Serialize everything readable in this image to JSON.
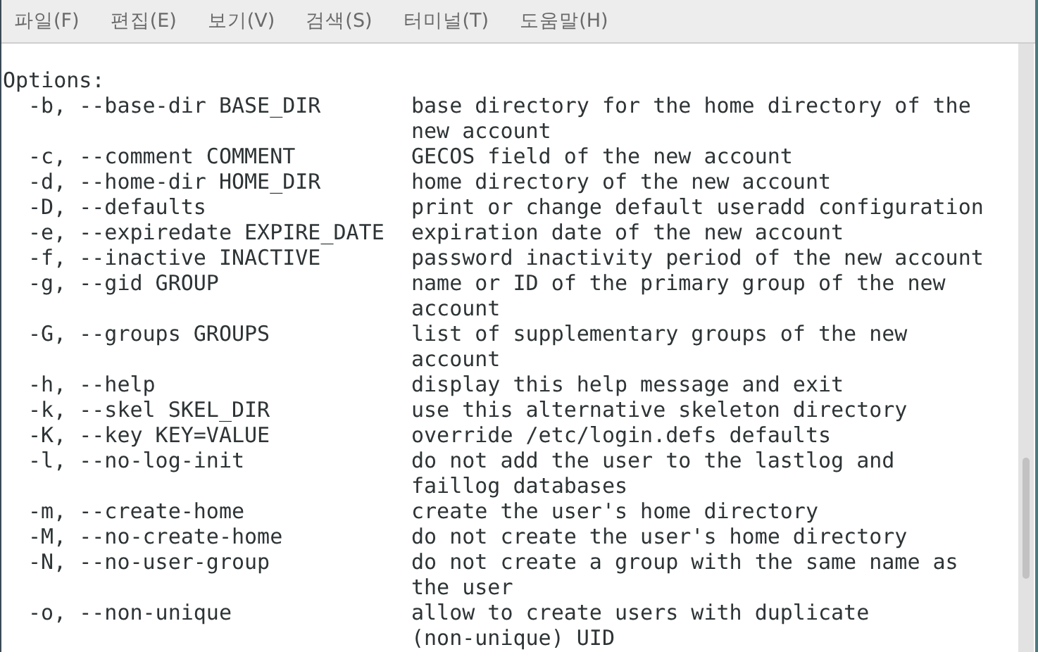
{
  "menu": [
    {
      "label": "파일(F)"
    },
    {
      "label": "편집(E)"
    },
    {
      "label": "보기(V)"
    },
    {
      "label": "검색(S)"
    },
    {
      "label": "터미널(T)"
    },
    {
      "label": "도움말(H)"
    }
  ],
  "terminal": {
    "heading": "Options:",
    "options": [
      {
        "flag": "-b, --base-dir BASE_DIR",
        "description": [
          "base directory for the home directory of the",
          "new account"
        ]
      },
      {
        "flag": "-c, --comment COMMENT",
        "description": [
          "GECOS field of the new account"
        ]
      },
      {
        "flag": "-d, --home-dir HOME_DIR",
        "description": [
          "home directory of the new account"
        ]
      },
      {
        "flag": "-D, --defaults",
        "description": [
          "print or change default useradd configuration"
        ]
      },
      {
        "flag": "-e, --expiredate EXPIRE_DATE",
        "description": [
          "expiration date of the new account"
        ]
      },
      {
        "flag": "-f, --inactive INACTIVE",
        "description": [
          "password inactivity period of the new account"
        ]
      },
      {
        "flag": "-g, --gid GROUP",
        "description": [
          "name or ID of the primary group of the new",
          "account"
        ]
      },
      {
        "flag": "-G, --groups GROUPS",
        "description": [
          "list of supplementary groups of the new",
          "account"
        ]
      },
      {
        "flag": "-h, --help",
        "description": [
          "display this help message and exit"
        ]
      },
      {
        "flag": "-k, --skel SKEL_DIR",
        "description": [
          "use this alternative skeleton directory"
        ]
      },
      {
        "flag": "-K, --key KEY=VALUE",
        "description": [
          "override /etc/login.defs defaults"
        ]
      },
      {
        "flag": "-l, --no-log-init",
        "description": [
          "do not add the user to the lastlog and",
          "faillog databases"
        ]
      },
      {
        "flag": "-m, --create-home",
        "description": [
          "create the user's home directory"
        ]
      },
      {
        "flag": "-M, --no-create-home",
        "description": [
          "do not create the user's home directory"
        ]
      },
      {
        "flag": "-N, --no-user-group",
        "description": [
          "do not create a group with the same name as",
          "the user"
        ]
      },
      {
        "flag": "-o, --non-unique",
        "description": [
          "allow to create users with duplicate",
          "(non-unique) UID"
        ]
      }
    ]
  }
}
